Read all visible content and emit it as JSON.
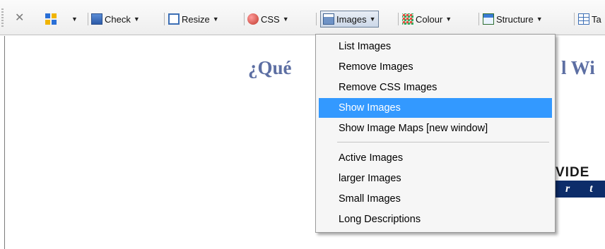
{
  "toolbar": {
    "items": [
      {
        "label": ""
      },
      {
        "label": "Check"
      },
      {
        "label": "Resize"
      },
      {
        "label": "CSS"
      },
      {
        "label": "Images"
      },
      {
        "label": "Colour"
      },
      {
        "label": "Structure"
      },
      {
        "label": "Ta"
      }
    ]
  },
  "page": {
    "heading_left": "¿Qué",
    "heading_right": "l Wi",
    "logo_top": "VIDE",
    "logo_bottom": "r t"
  },
  "menu": {
    "items": [
      {
        "label": "List Images"
      },
      {
        "label": "Remove Images"
      },
      {
        "label": "Remove CSS Images"
      },
      {
        "label": "Show Images",
        "selected": true
      },
      {
        "label": "Show Image Maps [new window]"
      },
      {
        "label": "Active Images"
      },
      {
        "label": "larger Images"
      },
      {
        "label": "Small Images"
      },
      {
        "label": "Long Descriptions"
      }
    ]
  },
  "colors": {
    "selection": "#3399ff",
    "heading": "#5d6fa3",
    "logo_bar": "#0d2d6a"
  }
}
